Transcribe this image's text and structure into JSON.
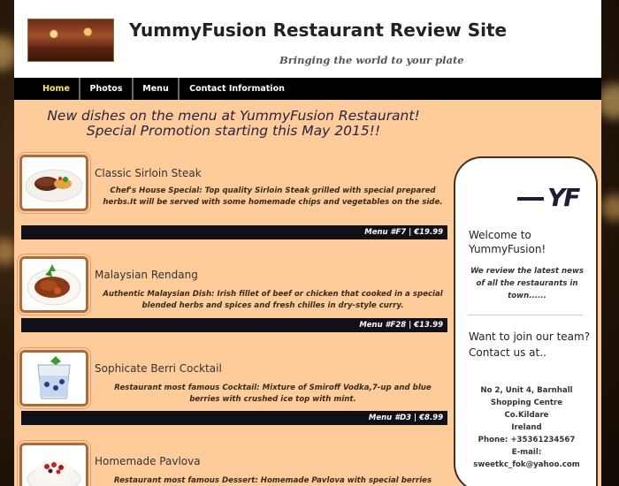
{
  "header": {
    "title": "YummyFusion Restaurant Review Site",
    "tagline": "Bringing the world to your plate"
  },
  "nav": {
    "items": [
      "Home",
      "Photos",
      "Menu",
      "Contact Information"
    ],
    "active": "Home"
  },
  "promo": {
    "line1": "New dishes on the menu at YummyFusion Restaurant!",
    "line2": "Special Promotion starting this May 2015!!"
  },
  "dishes": [
    {
      "name": "Classic Sirloin Steak",
      "description": "Chef's House Special: Top quality Sirloin Steak grilled with special prepared herbs.It will be served with some homemade chips and vegetables on the side.",
      "menu_info": "Menu #F7 | €19.99"
    },
    {
      "name": "Malaysian Rendang",
      "description": "Authentic Malaysian Dish: Irish fillet of beef or chicken that cooked in a special blended herbs and spices and fresh chilles in dry-style curry.",
      "menu_info": "Menu #F28 | €13.99"
    },
    {
      "name": "Sophicate Berri Cocktail",
      "description": "Restaurant most famous Cocktail: Mixture of Smiroff Vodka,7-up and blue berries with crushed ice top with mint.",
      "menu_info": "Menu #D3 | €8.99"
    },
    {
      "name": "Homemade Pavlova",
      "description": "Restaurant most famous Dessert: Homemade Pavlova with special berries"
    }
  ],
  "sidebar": {
    "logo_text": "YF",
    "welcome": "Welcome to YummyFusion!",
    "review": "We review the latest news of all the restaurants in town......",
    "join": "Want to join our team? Contact us at..",
    "address_lines": [
      "No 2, Unit 4, Barnhall",
      "Shopping Centre",
      "Co.Kildare",
      "Ireland",
      "Phone: +35361234567",
      "E-mail:",
      "sweetkc_fok@yahoo.com"
    ]
  },
  "colors": {
    "content_bg": "#fecb9b",
    "nav_bg": "#000000",
    "nav_active": "#ffe45a",
    "price_bar": "#111018",
    "sidebar_border": "#4a3018"
  },
  "icons": [
    "steak-photo",
    "rendang-photo",
    "cocktail-photo",
    "pavlova-photo",
    "restaurant-photo"
  ]
}
